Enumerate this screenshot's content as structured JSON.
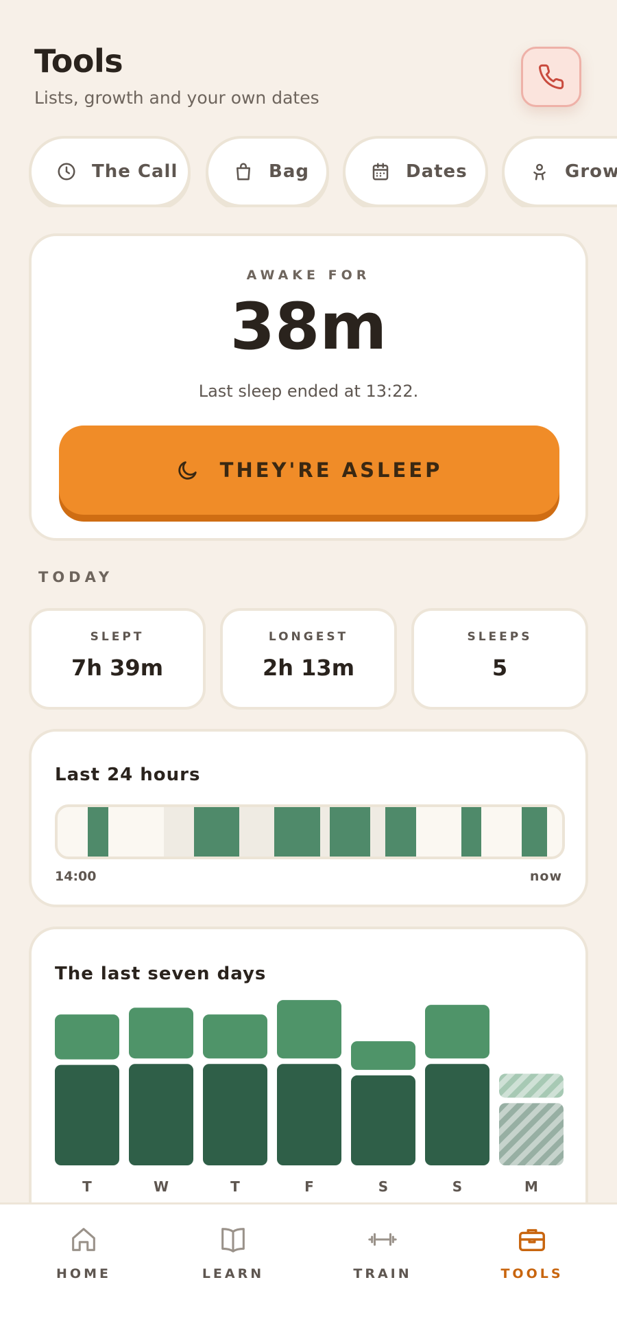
{
  "header": {
    "title": "Tools",
    "subtitle": "Lists, growth and your own dates",
    "call_icon": "phone-icon"
  },
  "chips": [
    {
      "label": "The Call",
      "icon": "clock-icon"
    },
    {
      "label": "Bag",
      "icon": "bag-icon"
    },
    {
      "label": "Dates",
      "icon": "calendar-icon"
    },
    {
      "label": "Growth",
      "icon": "baby-icon"
    }
  ],
  "awake": {
    "label": "AWAKE FOR",
    "value": "38m",
    "subtitle": "Last sleep ended at 13:22.",
    "button_label": "THEY'RE ASLEEP",
    "button_icon": "moon-icon"
  },
  "today": {
    "section_label": "TODAY",
    "stats": [
      {
        "label": "SLEPT",
        "value": "7h 39m"
      },
      {
        "label": "LONGEST",
        "value": "2h 13m"
      },
      {
        "label": "SLEEPS",
        "value": "5"
      }
    ]
  },
  "timeline": {
    "title": "Last 24 hours",
    "start_label": "14:00",
    "end_label": "now",
    "segments": [
      {
        "start": 0.06,
        "end": 0.1,
        "type": "sleep"
      },
      {
        "start": 0.1,
        "end": 0.21,
        "type": "awake"
      },
      {
        "start": 0.21,
        "end": 0.27,
        "type": "night"
      },
      {
        "start": 0.27,
        "end": 0.36,
        "type": "sleep"
      },
      {
        "start": 0.36,
        "end": 0.43,
        "type": "night"
      },
      {
        "start": 0.43,
        "end": 0.52,
        "type": "sleep"
      },
      {
        "start": 0.52,
        "end": 0.54,
        "type": "night"
      },
      {
        "start": 0.54,
        "end": 0.62,
        "type": "sleep"
      },
      {
        "start": 0.62,
        "end": 0.65,
        "type": "night"
      },
      {
        "start": 0.65,
        "end": 0.71,
        "type": "sleep"
      },
      {
        "start": 0.71,
        "end": 0.8,
        "type": "awake"
      },
      {
        "start": 0.8,
        "end": 0.84,
        "type": "sleep"
      },
      {
        "start": 0.84,
        "end": 0.92,
        "type": "awake"
      },
      {
        "start": 0.92,
        "end": 0.97,
        "type": "sleep"
      }
    ],
    "colors": {
      "sleep": "#4f8a6a",
      "awake": "#fbf8f2",
      "night": "#efebe3"
    }
  },
  "chart_data": {
    "type": "bar",
    "title": "The last seven days",
    "categories": [
      "T",
      "W",
      "T",
      "F",
      "S",
      "S",
      "M"
    ],
    "series": [
      {
        "values": [
          10.5,
          10.6,
          10.6,
          10.6,
          9.4,
          10.6,
          6.5
        ]
      },
      {
        "values": [
          4.7,
          5.3,
          4.6,
          6.1,
          3.0,
          5.6,
          2.5
        ]
      }
    ],
    "stacked": true,
    "ylim": [
      0,
      17.5
    ],
    "grid": false,
    "colors": [
      "#2f5f48",
      "#4f9469"
    ],
    "partial_last_day": true
  },
  "nav": [
    {
      "label": "HOME",
      "icon": "home-icon",
      "active": false
    },
    {
      "label": "LEARN",
      "icon": "book-icon",
      "active": false
    },
    {
      "label": "TRAIN",
      "icon": "dumbbell-icon",
      "active": false
    },
    {
      "label": "TOOLS",
      "icon": "toolbox-icon",
      "active": true
    }
  ]
}
